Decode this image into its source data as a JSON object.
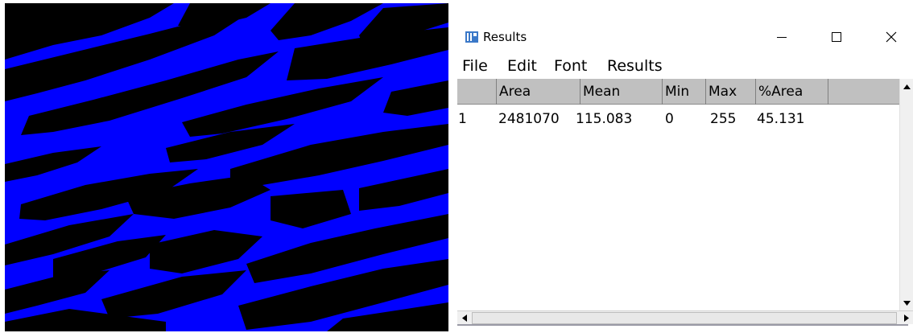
{
  "image_panel": {
    "description_colors": {
      "foreground": "#0000ff",
      "background": "#000000"
    }
  },
  "window": {
    "title": "Results",
    "icon": "imagej-results-icon",
    "controls": {
      "minimize": "minimize-icon",
      "maximize": "maximize-icon",
      "close": "close-icon"
    }
  },
  "menu": [
    "File",
    "Edit",
    "Font",
    "Results"
  ],
  "table": {
    "columns": [
      "Area",
      "Mean",
      "Min",
      "Max",
      "%Area"
    ],
    "rows": [
      {
        "index": "1",
        "values": [
          "2481070",
          "115.083",
          "0",
          "255",
          "45.131"
        ]
      }
    ]
  },
  "scrollbars": {
    "up": "scroll-up-icon",
    "down": "scroll-down-icon",
    "left": "scroll-left-icon",
    "right": "scroll-right-icon"
  },
  "colors": {
    "header_bg": "#c0c0c0",
    "scrollbar_bg": "#f0f0f0",
    "image_blue": "#0000ff"
  }
}
